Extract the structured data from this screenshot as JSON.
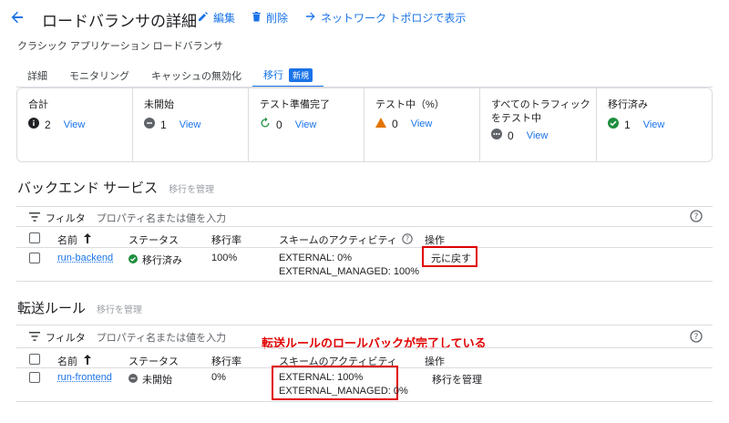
{
  "header": {
    "title": "ロードバランサの詳細",
    "edit_label": "編集",
    "delete_label": "削除",
    "topology_label": "ネットワーク トポロジで表示"
  },
  "subtitle": "クラシック アプリケーション ロードバランサ",
  "tabs": [
    {
      "label": "詳細"
    },
    {
      "label": "モニタリング"
    },
    {
      "label": "キャッシュの無効化"
    },
    {
      "label": "移行",
      "badge": "新規"
    }
  ],
  "summary": [
    {
      "label": "合計",
      "count": "2",
      "icon": "info-icon",
      "link": "View"
    },
    {
      "label": "未開始",
      "count": "1",
      "icon": "not-started-icon",
      "link": "View"
    },
    {
      "label": "テスト準備完了",
      "count": "0",
      "icon": "refresh-icon",
      "link": "View"
    },
    {
      "label": "テスト中（%）",
      "count": "0",
      "icon": "warning-icon",
      "link": "View"
    },
    {
      "label": "すべてのトラフィック をテスト中",
      "count": "0",
      "icon": "pending-icon",
      "link": "View"
    },
    {
      "label": "移行済み",
      "count": "1",
      "icon": "check-icon",
      "link": "View"
    }
  ],
  "backend": {
    "title": "バックエンド サービス",
    "manage_link": "移行を管理",
    "filter_label": "フィルタ",
    "filter_placeholder": "プロパティ名または値を入力",
    "columns": [
      "名前",
      "ステータス",
      "移行率",
      "スキームのアクティビティ",
      "操作"
    ],
    "row": {
      "name": "run-backend",
      "status": "移行済み",
      "rate": "100%",
      "activity_1": "EXTERNAL: 0%",
      "activity_2": "EXTERNAL_MANAGED: 100%",
      "action": "元に戻す"
    }
  },
  "forwarding": {
    "title": "転送ルール",
    "manage_link": "移行を管理",
    "filter_label": "フィルタ",
    "filter_placeholder": "プロパティ名または値を入力",
    "columns": [
      "名前",
      "ステータス",
      "移行率",
      "スキームのアクティビティ",
      "操作"
    ],
    "row": {
      "name": "run-frontend",
      "status": "未開始",
      "rate": "0%",
      "activity_1": "EXTERNAL: 100%",
      "activity_2": "EXTERNAL_MANAGED: 0%",
      "action": "移行を管理"
    }
  },
  "annotation": "転送ルールのロールバックが完了している",
  "colors": {
    "accent": "#1a73e8",
    "success": "#1e8e3e",
    "warning": "#e37400",
    "annotation_red": "#e00000"
  }
}
